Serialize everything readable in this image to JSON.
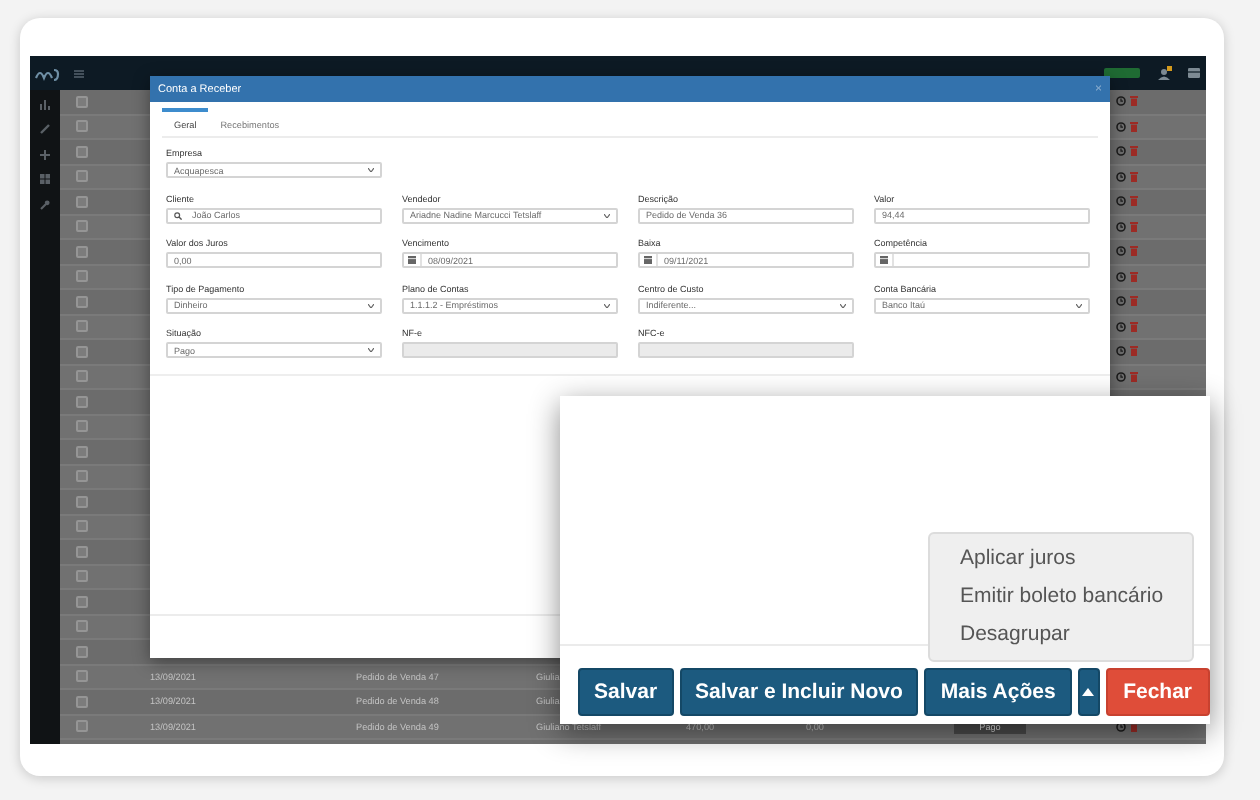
{
  "table": {
    "rows": [
      {
        "checked": false,
        "actions": true
      },
      {
        "checked": false,
        "actions": true
      },
      {
        "checked": false,
        "actions": true
      },
      {
        "checked": false,
        "actions": true
      },
      {
        "checked": false,
        "actions": true
      },
      {
        "checked": false,
        "actions": true
      },
      {
        "checked": false,
        "actions": true
      },
      {
        "checked": false,
        "actions": true
      },
      {
        "checked": false,
        "actions": true
      },
      {
        "checked": false,
        "actions": true
      },
      {
        "checked": false,
        "actions": true
      },
      {
        "checked": false,
        "actions": true
      },
      {
        "checked": false
      },
      {
        "checked": false
      },
      {
        "checked": false
      },
      {
        "checked": false
      },
      {
        "checked": false
      },
      {
        "checked": false
      },
      {
        "checked": false
      },
      {
        "checked": false
      },
      {
        "checked": false
      },
      {
        "checked": false
      },
      {
        "checked": false
      },
      {
        "checked": false,
        "cells": [
          "13/09/2021",
          "Pedido de Venda 47",
          "Giulia"
        ]
      },
      {
        "checked": false,
        "cells": [
          "13/09/2021",
          "Pedido de Venda 48",
          "Giulia"
        ]
      },
      {
        "checked": false,
        "cells": [
          "13/09/2021",
          "Pedido de Venda 49",
          "Giuliano Tetslaff",
          "470,00",
          "0,00"
        ],
        "status": "Pago",
        "actions": true
      }
    ]
  },
  "modal": {
    "title": "Conta a Receber",
    "close": "×",
    "tabs": [
      {
        "label": "Geral",
        "selected": true
      },
      {
        "label": "Recebimentos",
        "selected": false
      }
    ],
    "form_rows": [
      [
        {
          "label": "Empresa",
          "kind": "select",
          "value": "Acquapesca",
          "disabled": false
        }
      ],
      [
        {
          "label": "Cliente",
          "kind": "search",
          "value": "João Carlos",
          "disabled": false
        },
        {
          "label": "Vendedor",
          "kind": "select",
          "value": "Ariadne Nadine Marcucci Tetslaff",
          "disabled": false
        },
        {
          "label": "Descrição",
          "kind": "text",
          "value": "Pedido de Venda 36",
          "disabled": false
        },
        {
          "label": "Valor",
          "kind": "text",
          "value": "94,44",
          "disabled": false
        }
      ],
      [
        {
          "label": "Valor dos Juros",
          "kind": "text",
          "value": "0,00",
          "disabled": false
        },
        {
          "label": "Vencimento",
          "kind": "date",
          "value": "08/09/2021",
          "disabled": false
        },
        {
          "label": "Baixa",
          "kind": "date",
          "value": "09/11/2021",
          "disabled": false
        },
        {
          "label": "Competência",
          "kind": "date",
          "disabled": false
        }
      ],
      [
        {
          "label": "Tipo de Pagamento",
          "kind": "select",
          "value": "Dinheiro",
          "disabled": false
        },
        {
          "label": "Plano de Contas",
          "kind": "select",
          "value": "1.1.1.2 - Empréstimos",
          "disabled": false
        },
        {
          "label": "Centro de Custo",
          "kind": "select",
          "value": "Indiferente...",
          "disabled": false
        },
        {
          "label": "Conta Bancária",
          "kind": "select",
          "value": "Banco Itaú",
          "disabled": false
        }
      ],
      [
        {
          "label": "Situação",
          "kind": "select",
          "value": "Pago",
          "disabled": false
        },
        {
          "label": "NF-e",
          "kind": "text",
          "disabled": true
        },
        {
          "label": "NFC-e",
          "kind": "text",
          "disabled": true
        }
      ]
    ]
  },
  "footer_zoom": {
    "buttons": [
      {
        "kind": "primary",
        "label": "Salvar"
      },
      {
        "kind": "primary",
        "label": "Salvar e Incluir Novo"
      },
      {
        "kind": "primary",
        "label": "Mais Ações"
      },
      {
        "kind": "toggle",
        "expanded": true
      },
      {
        "kind": "danger",
        "label": "Fechar"
      }
    ],
    "menu": [
      "Aplicar juros",
      "Emitir boleto bancário",
      "Desagrupar"
    ]
  }
}
